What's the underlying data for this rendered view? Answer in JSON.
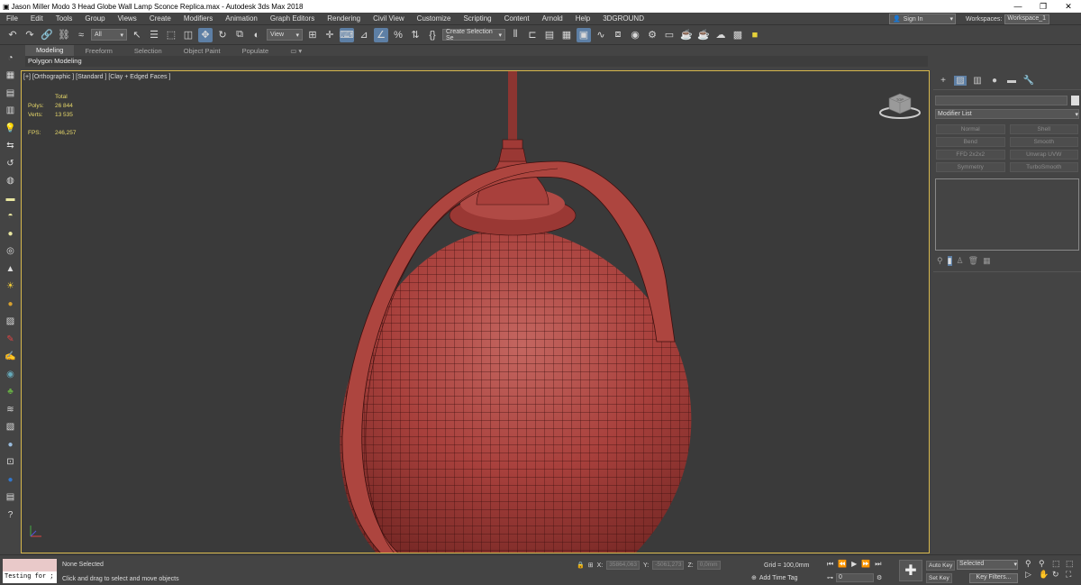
{
  "window": {
    "title": "Jason Miller Modo 3 Head Globe Wall Lamp Sconce Replica.max - Autodesk 3ds Max 2018",
    "app_icon": "3ds-max-icon",
    "minimize": "—",
    "maximize": "❐",
    "close": "✕"
  },
  "menu": {
    "items": [
      "File",
      "Edit",
      "Tools",
      "Group",
      "Views",
      "Create",
      "Modifiers",
      "Animation",
      "Graph Editors",
      "Rendering",
      "Civil View",
      "Customize",
      "Scripting",
      "Content",
      "Arnold",
      "Help",
      "3DGROUND"
    ],
    "sign_in": "Sign In",
    "workspaces_label": "Workspaces:",
    "workspace_value": "Workspace_1"
  },
  "toolbar": {
    "selection_filter": "All",
    "ref_coord": "View",
    "named_selection": "Create Selection Se"
  },
  "ribbon": {
    "tabs": [
      "Modeling",
      "Freeform",
      "Selection",
      "Object Paint",
      "Populate"
    ],
    "active_tab": "Modeling",
    "sub_label": "Polygon Modeling"
  },
  "viewport": {
    "label": "[+] [Orthographic ] [Standard ] [Clay + Edged Faces ]",
    "stats": {
      "header": "Total",
      "polys_label": "Polys:",
      "polys_value": "26 844",
      "verts_label": "Verts:",
      "verts_value": "13 535",
      "fps_label": "FPS:",
      "fps_value": "246,257"
    },
    "viewcube_label": "TOP",
    "colors": {
      "model": "#a8403c",
      "wire": "#3c0f0e",
      "border": "#d8b84c",
      "background": "#3a3a3a"
    }
  },
  "command_panel": {
    "modifier_list": "Modifier List",
    "buttons": [
      "Normal",
      "Shell",
      "Bend",
      "Smooth",
      "FFD 2x2x2",
      "Unwrap UVW",
      "Symmetry",
      "TurboSmooth"
    ]
  },
  "status": {
    "selection_status": "None Selected",
    "prompt": "Click and drag to select and move objects",
    "maxscript": "Testing for ;",
    "x_label": "X:",
    "x_value": "35864,063",
    "y_label": "Y:",
    "y_value": "-5061,273",
    "z_label": "Z:",
    "z_value": "0,0mm",
    "grid": "Grid = 100,0mm",
    "add_time_tag": "Add Time Tag",
    "frame": "0",
    "auto_key": "Auto Key",
    "set_key": "Set Key",
    "selected": "Selected",
    "key_filters": "Key Filters..."
  }
}
